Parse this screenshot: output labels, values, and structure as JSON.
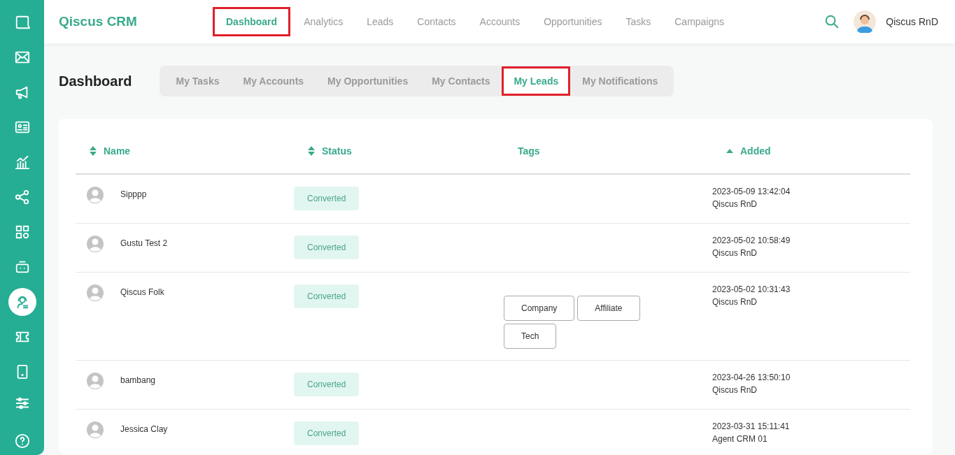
{
  "sidebar": {
    "items": [
      {
        "kind": "chat",
        "selected": false
      },
      {
        "kind": "mail",
        "selected": false
      },
      {
        "kind": "megaphone",
        "selected": false
      },
      {
        "kind": "card",
        "selected": false
      },
      {
        "kind": "chart",
        "selected": false
      },
      {
        "kind": "share",
        "selected": false
      },
      {
        "kind": "grid",
        "selected": false
      },
      {
        "kind": "robot",
        "selected": false
      },
      {
        "kind": "agent",
        "selected": true
      },
      {
        "kind": "ticket",
        "selected": false
      },
      {
        "kind": "tablet",
        "selected": false
      }
    ],
    "bottom_items": [
      {
        "kind": "sliders",
        "selected": false
      },
      {
        "kind": "help",
        "selected": false
      }
    ]
  },
  "header": {
    "brand": "Qiscus CRM",
    "nav": [
      {
        "label": "Dashboard",
        "selected": true,
        "highlighted": true
      },
      {
        "label": "Analytics",
        "selected": false,
        "highlighted": false
      },
      {
        "label": "Leads",
        "selected": false,
        "highlighted": false
      },
      {
        "label": "Contacts",
        "selected": false,
        "highlighted": false
      },
      {
        "label": "Accounts",
        "selected": false,
        "highlighted": false
      },
      {
        "label": "Opportunities",
        "selected": false,
        "highlighted": false
      },
      {
        "label": "Tasks",
        "selected": false,
        "highlighted": false
      },
      {
        "label": "Campaigns",
        "selected": false,
        "highlighted": false
      }
    ],
    "user": "Qiscus RnD"
  },
  "page": {
    "title": "Dashboard",
    "tabs": [
      {
        "label": "My Tasks",
        "selected": false,
        "highlighted": false
      },
      {
        "label": "My Accounts",
        "selected": false,
        "highlighted": false
      },
      {
        "label": "My Opportunities",
        "selected": false,
        "highlighted": false
      },
      {
        "label": "My Contacts",
        "selected": false,
        "highlighted": false
      },
      {
        "label": "My Leads",
        "selected": true,
        "highlighted": true
      },
      {
        "label": "My Notifications",
        "selected": false,
        "highlighted": false
      }
    ]
  },
  "table": {
    "columns": [
      {
        "label": "Name",
        "kind": "sortable"
      },
      {
        "label": "Status",
        "kind": "sortable"
      },
      {
        "label": "Tags",
        "kind": "plain"
      },
      {
        "label": "Added",
        "kind": "ascending"
      }
    ],
    "rows": [
      {
        "name": "Sipppp",
        "status": "Converted",
        "tags": [],
        "added": "2023-05-09 13:42:04",
        "by": "Qiscus RnD"
      },
      {
        "name": "Gustu Test 2",
        "status": "Converted",
        "tags": [],
        "added": "2023-05-02 10:58:49",
        "by": "Qiscus RnD"
      },
      {
        "name": "Qiscus Folk",
        "status": "Converted",
        "tags": [
          "Company",
          "Affiliate",
          "Tech"
        ],
        "added": "2023-05-02 10:31:43",
        "by": "Qiscus RnD"
      },
      {
        "name": "bambang",
        "status": "Converted",
        "tags": [],
        "added": "2023-04-26 13:50:10",
        "by": "Qiscus RnD"
      },
      {
        "name": "Jessica Clay",
        "status": "Converted",
        "tags": [],
        "added": "2023-03-31 15:11:41",
        "by": "Agent CRM 01"
      }
    ]
  }
}
